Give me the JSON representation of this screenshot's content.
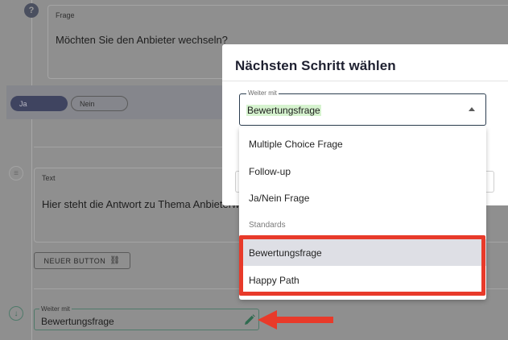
{
  "question_card": {
    "label": "Frage",
    "text": "Möchten Sie den Anbieter wechseln?"
  },
  "answers": {
    "yes": "Ja",
    "no": "Nein"
  },
  "text_card": {
    "label": "Text",
    "text": "Hier steht die Antwort zu Thema Anbieterwechsel."
  },
  "new_button": {
    "label": "NEUER BUTTON"
  },
  "next_step_field": {
    "label": "Weiter mit",
    "value": "Bewertungsfrage"
  },
  "modal": {
    "title": "Nächsten Schritt wählen",
    "select": {
      "label": "Weiter mit",
      "value": "Bewertungsfrage"
    },
    "options": [
      {
        "label": "Multiple Choice Frage"
      },
      {
        "label": "Follow-up"
      },
      {
        "label": "Ja/Nein Frage"
      }
    ],
    "group_header": "Standards",
    "group_options": [
      {
        "label": "Bewertungsfrage",
        "selected": true
      },
      {
        "label": "Happy Path",
        "selected": false
      }
    ]
  },
  "colors": {
    "highlight": "#e83a2a",
    "selected_bg": "#d6f3cf",
    "accent": "#3f4460"
  }
}
